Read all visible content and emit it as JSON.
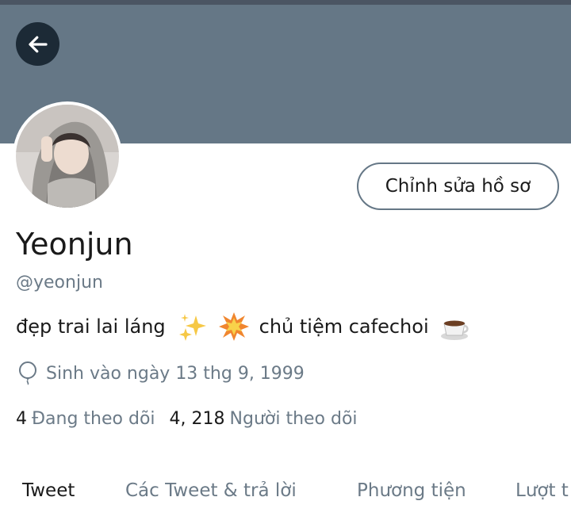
{
  "header": {
    "back_icon": "arrow-left-icon",
    "banner_color": "#657786"
  },
  "profile": {
    "avatar_icon": "profile-photo",
    "edit_button_label": "Chỉnh sửa hồ sơ",
    "name": "Yeonjun",
    "handle": "@yeonjun",
    "bio": {
      "part1": "đẹp trai lai láng",
      "emoji1": "sparkles-icon",
      "emoji2": "collision-icon",
      "part2": "chủ tiệm cafechoi",
      "emoji3": "coffee-cup-icon"
    },
    "birthday_icon": "balloon-icon",
    "birthday": "Sinh vào ngày 13 thg 9,  1999",
    "following_count": "4",
    "following_label": "Đang theo dõi",
    "followers_count": "4, 218",
    "followers_label": "Người theo dõi"
  },
  "tabs": [
    {
      "label": "Tweet",
      "active": true
    },
    {
      "label": "Các Tweet & trả lời",
      "active": false
    },
    {
      "label": "Phương tiện",
      "active": false
    },
    {
      "label": "Lượt t",
      "active": false
    }
  ],
  "colors": {
    "text": "#1a1a1a",
    "secondary": "#6b7a87",
    "back_button": "#1c2a36"
  }
}
